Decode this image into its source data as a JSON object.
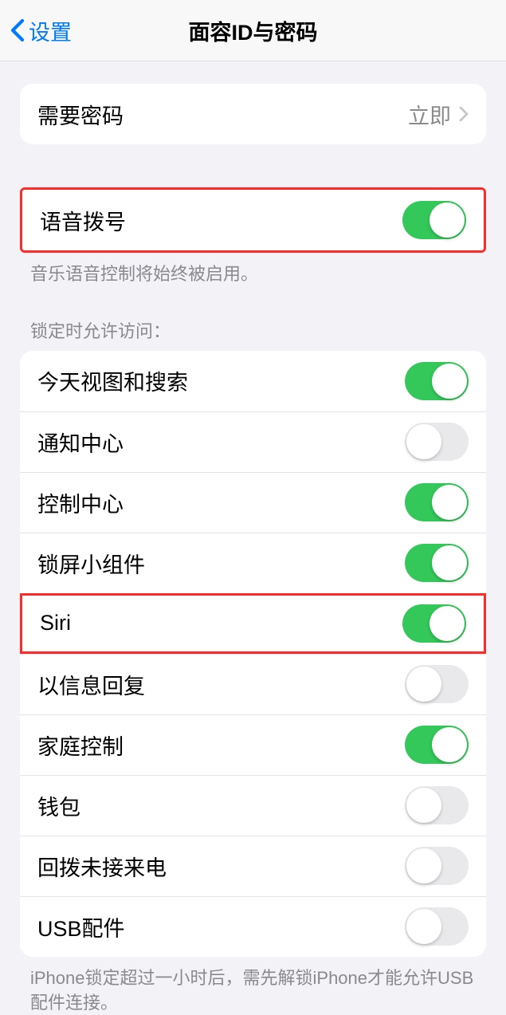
{
  "header": {
    "back_label": "设置",
    "title": "面容ID与密码"
  },
  "require_passcode": {
    "label": "需要密码",
    "value": "立即"
  },
  "voice_dial": {
    "label": "语音拨号",
    "footer": "音乐语音控制将始终被启用。",
    "on": true
  },
  "lock_section_header": "锁定时允许访问：",
  "lock_items": [
    {
      "label": "今天视图和搜索",
      "on": true
    },
    {
      "label": "通知中心",
      "on": false
    },
    {
      "label": "控制中心",
      "on": true
    },
    {
      "label": "锁屏小组件",
      "on": true
    },
    {
      "label": "Siri",
      "on": true
    },
    {
      "label": "以信息回复",
      "on": false
    },
    {
      "label": "家庭控制",
      "on": true
    },
    {
      "label": "钱包",
      "on": false
    },
    {
      "label": "回拨未接来电",
      "on": false
    },
    {
      "label": "USB配件",
      "on": false
    }
  ],
  "usb_footer": "iPhone锁定超过一小时后，需先解锁iPhone才能允许USB配件连接。",
  "highlight_indices": [
    4
  ]
}
